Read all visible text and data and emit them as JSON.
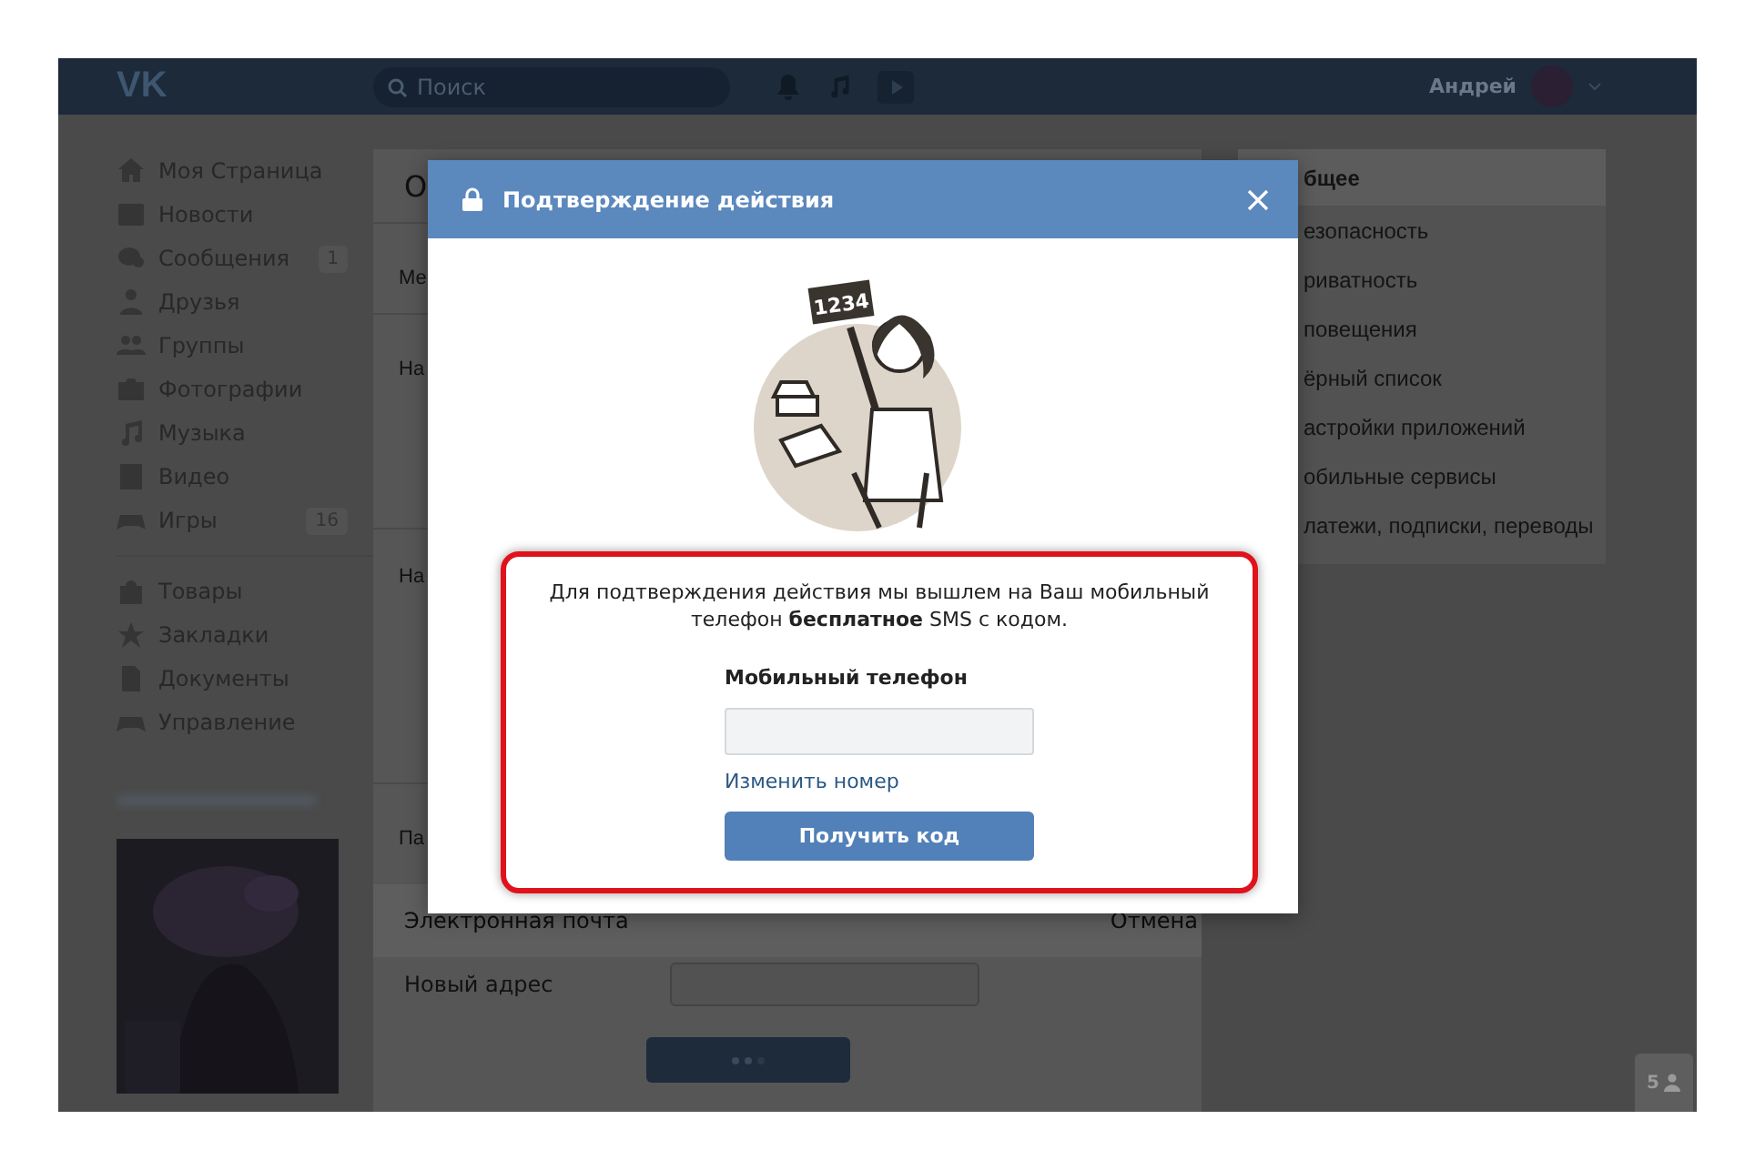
{
  "header": {
    "logo": "VK",
    "search": {
      "placeholder": "Поиск"
    },
    "user_name": "Андрей"
  },
  "sidebar": {
    "groups": [
      [
        {
          "label": "Моя Страница"
        },
        {
          "label": "Новости"
        },
        {
          "label": "Сообщения",
          "count": "1"
        },
        {
          "label": "Друзья"
        },
        {
          "label": "Группы"
        },
        {
          "label": "Фотографии"
        },
        {
          "label": "Музыка"
        },
        {
          "label": "Видео"
        },
        {
          "label": "Игры",
          "count": "16"
        }
      ],
      [
        {
          "label": "Товары"
        },
        {
          "label": "Закладки"
        },
        {
          "label": "Документы"
        },
        {
          "label": "Управление"
        }
      ]
    ]
  },
  "main": {
    "title": "О",
    "rows": [
      "Ме",
      "На",
      "На",
      "Па"
    ],
    "email_label": "Электронная почта",
    "cancel_link": "Отмена",
    "new_address_label": "Новый адрес"
  },
  "settings_menu": [
    {
      "label": "бщее",
      "selected": true
    },
    {
      "label": "езопасность",
      "selected": false
    },
    {
      "label": "риватность",
      "selected": false
    },
    {
      "label": "повещения",
      "selected": false
    },
    {
      "label": "ёрный список",
      "selected": false
    },
    {
      "label": "астройки приложений",
      "selected": false
    },
    {
      "label": "обильные сервисы",
      "selected": false
    },
    {
      "label": "латежи, подписки, переводы",
      "selected": false
    }
  ],
  "online_badge": "5",
  "dialog": {
    "title": "Подтверждение действия",
    "sign_text": "1234",
    "message": "Для подтверждения действия мы вышлем на Ваш мобильный телефон **бесплатное** SMS с кодом.",
    "phone_label": "Мобильный телефон",
    "change_link": "Изменить номер",
    "submit_button": "Получить код"
  }
}
